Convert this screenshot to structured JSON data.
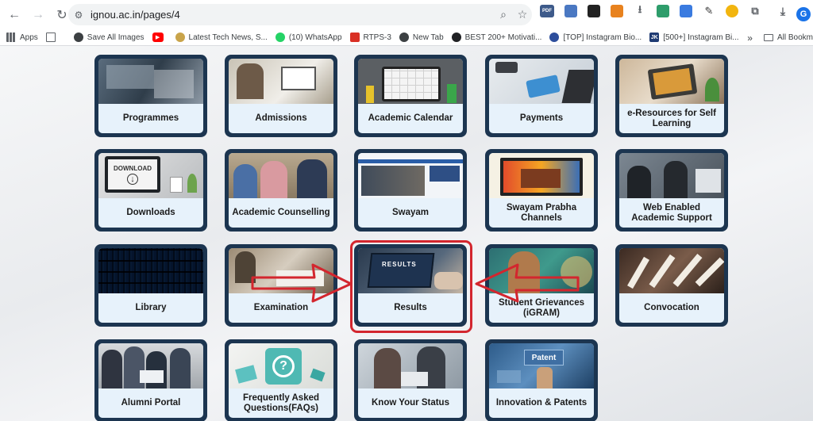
{
  "browser": {
    "url": "ignou.ac.in/pages/4",
    "profile_initial": "G",
    "extensions": [
      "PDF"
    ],
    "bookmarks": [
      {
        "label": "Apps",
        "icon": "apps-grid-icon"
      },
      {
        "label": "",
        "icon": "tab-groups-icon"
      },
      {
        "label": "Save All Images",
        "icon": "save-images-icon"
      },
      {
        "label": "",
        "icon": "youtube-icon"
      },
      {
        "label": "Latest Tech News, S...",
        "icon": "tech-news-icon"
      },
      {
        "label": "(10) WhatsApp",
        "icon": "whatsapp-icon"
      },
      {
        "label": "RTPS-3",
        "icon": "rtps-icon"
      },
      {
        "label": "New Tab",
        "icon": "new-tab-icon"
      },
      {
        "label": "BEST 200+ Motivati...",
        "icon": "motivation-icon"
      },
      {
        "label": "[TOP] Instagram Bio...",
        "icon": "instagram-bio-icon"
      },
      {
        "label": "[500+] Instagram Bi...",
        "icon": "jk-icon"
      }
    ],
    "all_bookmarks_label": "All Bookm"
  },
  "tiles": [
    {
      "label": "Programmes"
    },
    {
      "label": "Admissions"
    },
    {
      "label": "Academic Calendar"
    },
    {
      "label": "Payments"
    },
    {
      "label": "e-Resources for Self Learning"
    },
    {
      "label": "Downloads"
    },
    {
      "label": "Academic Counselling"
    },
    {
      "label": "Swayam"
    },
    {
      "label": "Swayam Prabha Channels"
    },
    {
      "label": "Web Enabled Academic Support"
    },
    {
      "label": "Library"
    },
    {
      "label": "Examination"
    },
    {
      "label": "Results"
    },
    {
      "label": "Student Grievances (iGRAM)"
    },
    {
      "label": "Convocation"
    },
    {
      "label": "Alumni Portal"
    },
    {
      "label": "Frequently Asked Questions(FAQs)"
    },
    {
      "label": "Know Your Status"
    },
    {
      "label": "Innovation & Patents"
    }
  ],
  "photo_text": {
    "download": "DOWNLOAD",
    "results": "RESULTS",
    "patent": "Patent"
  },
  "colors": {
    "tile_border": "#1c3550",
    "tile_bg": "#e7f2fb",
    "highlight": "#d3262e"
  }
}
